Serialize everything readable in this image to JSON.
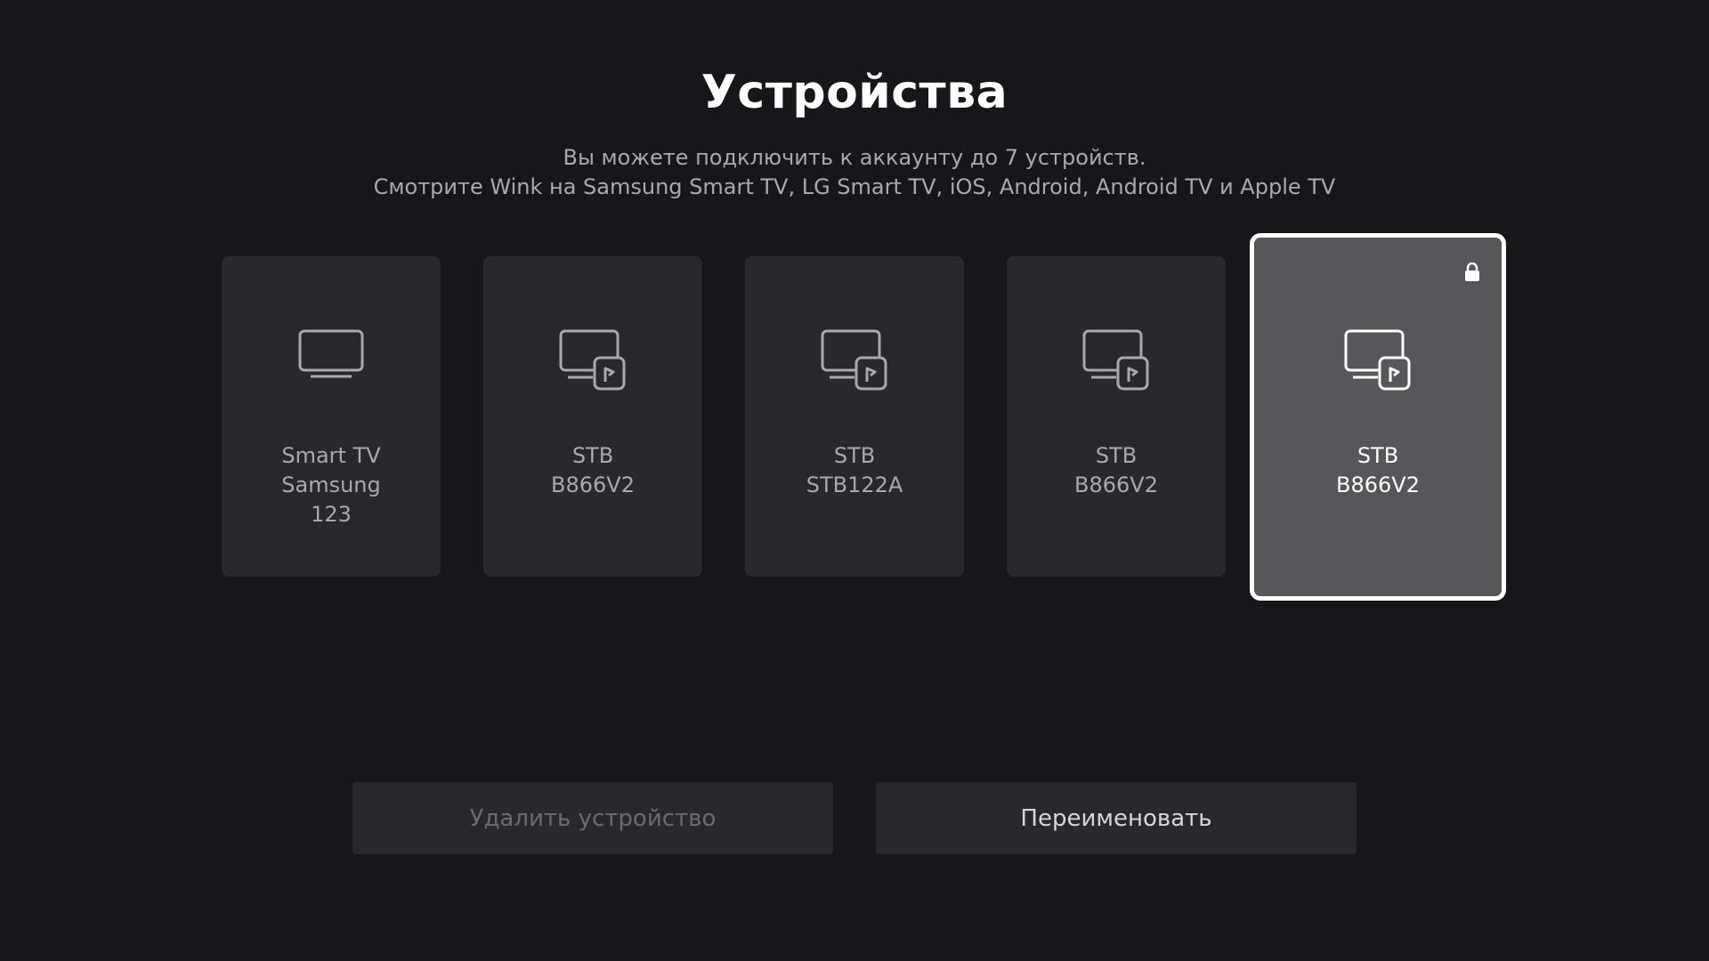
{
  "header": {
    "title": "Устройства",
    "subtitle_line1": "Вы можете подключить к аккаунту до 7 устройств.",
    "subtitle_line2": "Смотрите Wink на Samsung Smart TV, LG Smart TV, iOS, Android, Android TV и Apple TV"
  },
  "devices": [
    {
      "icon": "tv-icon",
      "lines": [
        "Smart TV",
        "Samsung",
        "123"
      ],
      "selected": false,
      "locked": false
    },
    {
      "icon": "set-top-box-icon",
      "lines": [
        "STB",
        "B866V2"
      ],
      "selected": false,
      "locked": false
    },
    {
      "icon": "set-top-box-icon",
      "lines": [
        "STB",
        "STB122A"
      ],
      "selected": false,
      "locked": false
    },
    {
      "icon": "set-top-box-icon",
      "lines": [
        "STB",
        "B866V2"
      ],
      "selected": false,
      "locked": false
    },
    {
      "icon": "set-top-box-icon",
      "lines": [
        "STB",
        "B866V2"
      ],
      "selected": true,
      "locked": true
    }
  ],
  "actions": {
    "delete_label": "Удалить устройство",
    "rename_label": "Переименовать"
  },
  "colors": {
    "background": "#17161b",
    "card": "#29282d",
    "card_selected": "#57565b",
    "text_muted": "#a9a9ad",
    "button_disabled_text": "#6b6a70"
  }
}
